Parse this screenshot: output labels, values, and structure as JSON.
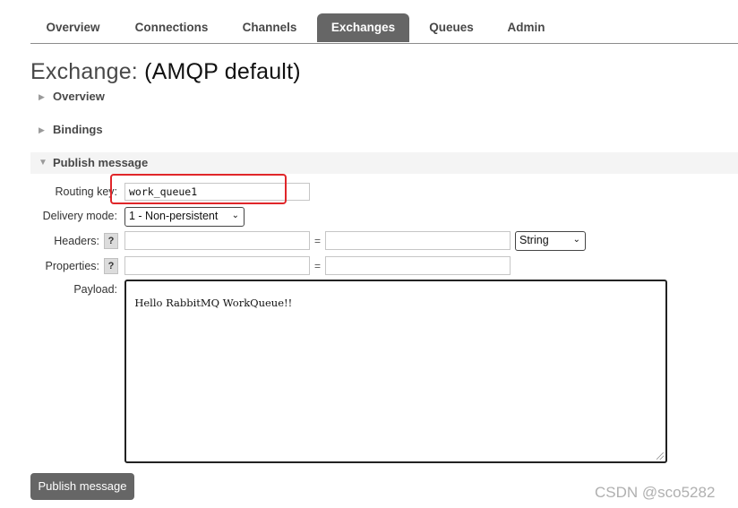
{
  "nav": {
    "tabs": [
      {
        "label": "Overview"
      },
      {
        "label": "Connections"
      },
      {
        "label": "Channels"
      },
      {
        "label": "Exchanges"
      },
      {
        "label": "Queues"
      },
      {
        "label": "Admin"
      }
    ],
    "active_tab": "Exchanges"
  },
  "page": {
    "title_prefix": "Exchange:",
    "title_value": "(AMQP default)"
  },
  "sections": {
    "overview": "Overview",
    "bindings": "Bindings",
    "publish": "Publish message"
  },
  "publish_form": {
    "routing_key_label": "Routing key:",
    "routing_key_value": "work_queue1",
    "delivery_mode_label": "Delivery mode:",
    "delivery_mode_value": "1 - Non-persistent",
    "headers_label": "Headers:",
    "headers_type_value": "String",
    "properties_label": "Properties:",
    "help_glyph": "?",
    "equals": "=",
    "payload_label": "Payload:",
    "payload_value": "Hello RabbitMQ WorkQueue!!",
    "submit_label": "Publish message"
  },
  "watermark": "CSDN @sco5282",
  "colors": {
    "active_tab_bg": "#666666",
    "button_bg": "#666666",
    "highlight_box": "#e0262a"
  },
  "icons": {
    "collapsed": "triangle-right-icon",
    "expanded": "triangle-down-icon",
    "select": "chevron-down-icon"
  }
}
